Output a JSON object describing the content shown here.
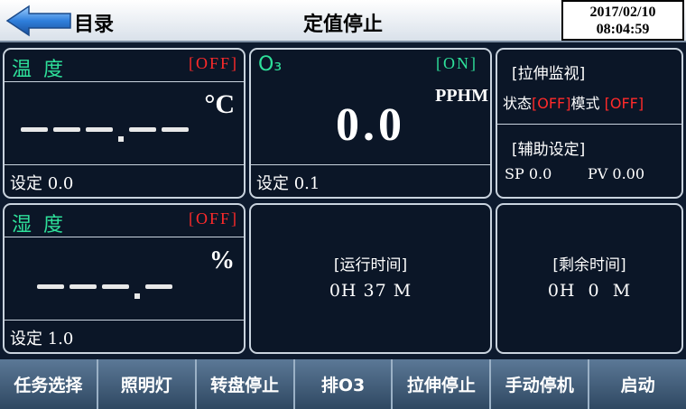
{
  "header": {
    "back_label": "目录",
    "title": "定值停止",
    "date": "2017/02/10",
    "time": "08:04:59"
  },
  "temperature": {
    "name": "温 度",
    "status": "[OFF]",
    "unit": "°C",
    "value": "---.--",
    "setting": "设定 0.0"
  },
  "ozone": {
    "name": "O₃",
    "status": "[ON]",
    "unit": "PPHM",
    "value": "0.0",
    "setting": "设定 0.1"
  },
  "stretch_monitor": {
    "title": "[拉伸监视]",
    "state_label": "状态",
    "state_value": "[OFF]",
    "mode_label": "模式",
    "mode_value": "[OFF]",
    "aux_title": "[辅助设定]",
    "sp": "SP 0.0",
    "pv": "PV 0.00"
  },
  "humidity": {
    "name": "湿 度",
    "status": "[OFF]",
    "unit": "%",
    "value": "---.-",
    "setting": "设定 1.0"
  },
  "run_time": {
    "label": "[运行时间]",
    "value": "0H 37 M"
  },
  "remaining_time": {
    "label": "[剩余时间]",
    "value": "0H  0  M"
  },
  "footer": {
    "buttons": [
      "任务选择",
      "照明灯",
      "转盘停止",
      "排O3",
      "拉伸停止",
      "手动停机",
      "启动"
    ]
  },
  "colors": {
    "background": "#0d1a2e",
    "on_green": "#2ee09a",
    "off_red": "#ff2a2a",
    "footer_blue": "#3f5b78"
  }
}
